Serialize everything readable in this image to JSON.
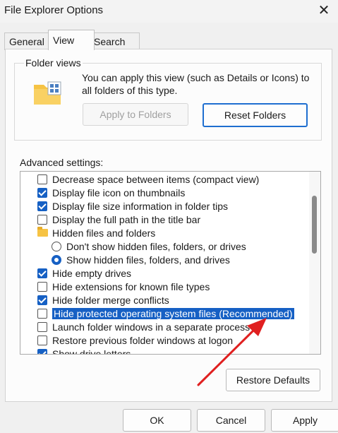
{
  "window": {
    "title": "File Explorer Options"
  },
  "tabs": [
    {
      "label": "General"
    },
    {
      "label": "View"
    },
    {
      "label": "Search"
    }
  ],
  "folder_views": {
    "label": "Folder views",
    "description": "You can apply this view (such as Details or Icons) to all folders of this type.",
    "apply_label": "Apply to Folders",
    "reset_label": "Reset Folders"
  },
  "advanced": {
    "label": "Advanced settings:",
    "items": [
      {
        "type": "checkbox",
        "label": "Decrease space between items (compact view)",
        "checked": false
      },
      {
        "type": "checkbox",
        "label": "Display file icon on thumbnails",
        "checked": true
      },
      {
        "type": "checkbox",
        "label": "Display file size information in folder tips",
        "checked": true
      },
      {
        "type": "checkbox",
        "label": "Display the full path in the title bar",
        "checked": false
      },
      {
        "type": "folder",
        "label": "Hidden files and folders"
      },
      {
        "type": "radio",
        "label": "Don't show hidden files, folders, or drives",
        "checked": false
      },
      {
        "type": "radio",
        "label": "Show hidden files, folders, and drives",
        "checked": true
      },
      {
        "type": "checkbox",
        "label": "Hide empty drives",
        "checked": true
      },
      {
        "type": "checkbox",
        "label": "Hide extensions for known file types",
        "checked": false
      },
      {
        "type": "checkbox",
        "label": "Hide folder merge conflicts",
        "checked": true
      },
      {
        "type": "checkbox",
        "label": "Hide protected operating system files (Recommended)",
        "checked": false,
        "selected": true
      },
      {
        "type": "checkbox",
        "label": "Launch folder windows in a separate process",
        "checked": false
      },
      {
        "type": "checkbox",
        "label": "Restore previous folder windows at logon",
        "checked": false
      },
      {
        "type": "checkbox",
        "label": "Show drive letters",
        "checked": true
      }
    ],
    "restore_label": "Restore Defaults"
  },
  "footer": {
    "ok_label": "OK",
    "cancel_label": "Cancel",
    "apply_label": "Apply"
  },
  "colors": {
    "accent": "#1660c4",
    "annotation_arrow": "#e02020"
  }
}
